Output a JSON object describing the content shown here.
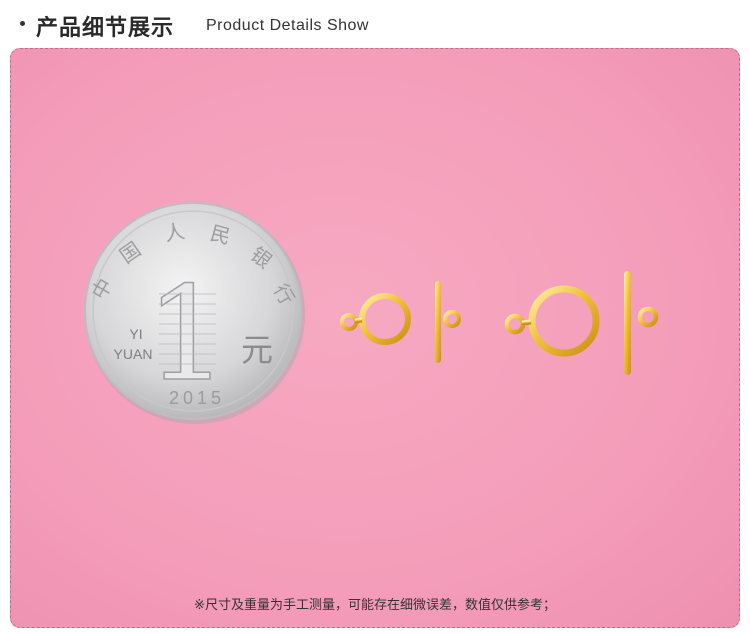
{
  "header": {
    "title_cn": "产品细节展示",
    "title_en": "Product Details Show"
  },
  "photo": {
    "coin": {
      "denomination": "1",
      "unit_cn": "元",
      "unit_pinyin_1": "YI",
      "unit_pinyin_2": "YUAN",
      "year": "2015",
      "issuer": "中国人民银行"
    }
  },
  "footer": {
    "note": "※尺寸及重量为手工测量，可能存在细微误差，数值仅供参考；"
  },
  "colors": {
    "background_pink": "#f49dba",
    "gold": "#f2c23a",
    "coin_silver": "#d9d9d9"
  }
}
